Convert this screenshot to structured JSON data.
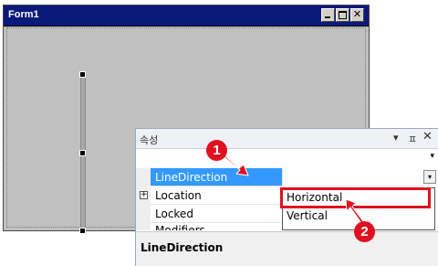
{
  "form": {
    "title": "Form1",
    "buttons": {
      "minimize": "",
      "maximize": "",
      "close": "✕"
    }
  },
  "properties": {
    "title": "속성",
    "titlebar_icons": {
      "dropdown": "▾",
      "pin": "ㅍ",
      "close": "✕"
    },
    "combo_arrow": "▾",
    "rows": [
      {
        "name": "LineDirection",
        "selected": true,
        "expander": ""
      },
      {
        "name": "Location",
        "selected": false,
        "expander": "+"
      },
      {
        "name": "Locked",
        "selected": false,
        "expander": ""
      },
      {
        "name": "Modifiers",
        "selected": false,
        "expander": ""
      }
    ],
    "value_dropdown_arrow": "▾",
    "description_title": "LineDirection"
  },
  "dropdown": {
    "options": [
      "Horizontal",
      "Vertical"
    ],
    "highlighted": "Horizontal"
  },
  "annotations": {
    "badge_1": "1",
    "badge_2": "2",
    "accent_color": "#e01020"
  },
  "colors": {
    "form_titlebar": "#0a1a7a",
    "form_body": "#c0c0c0",
    "selected_row": "#3399ff"
  }
}
